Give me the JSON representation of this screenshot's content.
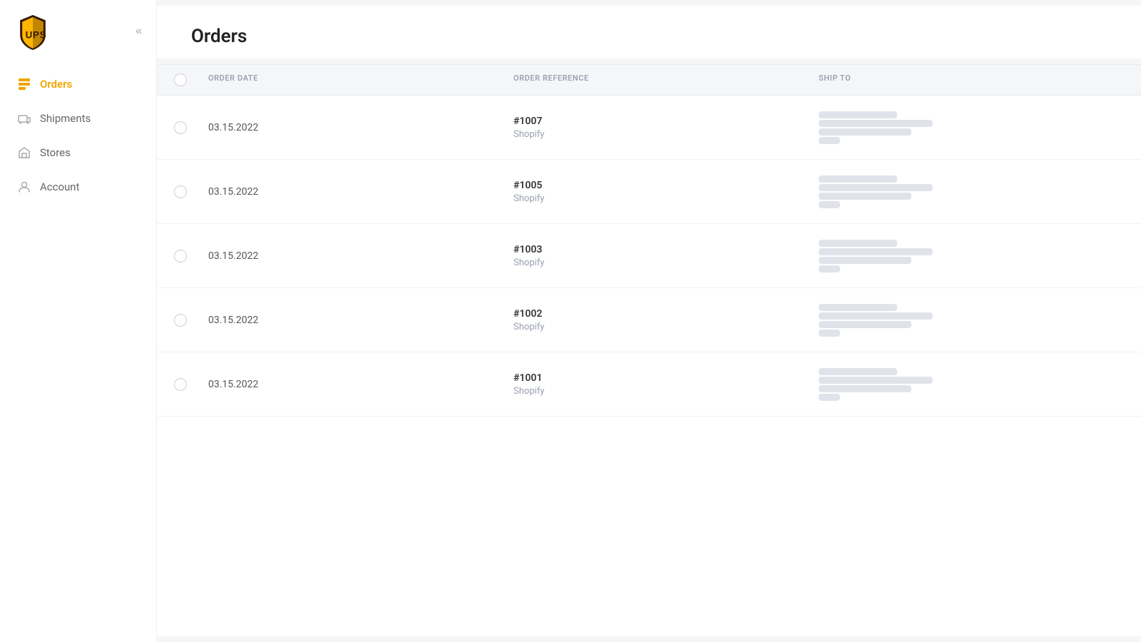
{
  "sidebar": {
    "logo_alt": "UPS Logo",
    "collapse_icon": "❮❮",
    "nav_items": [
      {
        "id": "orders",
        "label": "Orders",
        "icon": "orders-icon",
        "active": true
      },
      {
        "id": "shipments",
        "label": "Shipments",
        "icon": "shipments-icon",
        "active": false
      },
      {
        "id": "stores",
        "label": "Stores",
        "icon": "stores-icon",
        "active": false
      },
      {
        "id": "account",
        "label": "Account",
        "icon": "account-icon",
        "active": false
      }
    ]
  },
  "page": {
    "title": "Orders"
  },
  "table": {
    "columns": [
      {
        "id": "checkbox",
        "label": ""
      },
      {
        "id": "order_date",
        "label": "ORDER DATE"
      },
      {
        "id": "order_reference",
        "label": "ORDER REFERENCE"
      },
      {
        "id": "ship_to",
        "label": "SHIP TO"
      }
    ],
    "rows": [
      {
        "date": "03.15.2022",
        "ref_number": "#1007",
        "ref_source": "Shopify"
      },
      {
        "date": "03.15.2022",
        "ref_number": "#1005",
        "ref_source": "Shopify"
      },
      {
        "date": "03.15.2022",
        "ref_number": "#1003",
        "ref_source": "Shopify"
      },
      {
        "date": "03.15.2022",
        "ref_number": "#1002",
        "ref_source": "Shopify"
      },
      {
        "date": "03.15.2022",
        "ref_number": "#1001",
        "ref_source": "Shopify"
      }
    ]
  }
}
